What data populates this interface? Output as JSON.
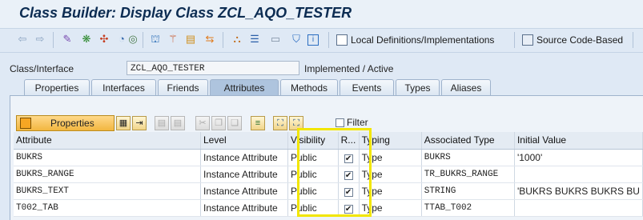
{
  "window": {
    "title": "Class Builder: Display Class ZCL_AQO_TESTER"
  },
  "toolbar": {
    "back_icon": "arrow-left-icon",
    "forward_icon": "arrow-right-icon",
    "local_definitions_label": "Local Definitions/Implementations",
    "source_code_label": "Source Code-Based"
  },
  "class_field": {
    "label": "Class/Interface",
    "value": "ZCL_AQO_TESTER",
    "status": "Implemented / Active"
  },
  "tabs": [
    {
      "label": "Properties"
    },
    {
      "label": "Interfaces"
    },
    {
      "label": "Friends"
    },
    {
      "label": "Attributes",
      "active": true
    },
    {
      "label": "Methods"
    },
    {
      "label": "Events"
    },
    {
      "label": "Types"
    },
    {
      "label": "Aliases"
    }
  ],
  "attributes_toolbar": {
    "properties_label": "Properties",
    "filter_label": "Filter",
    "filter_checked": false
  },
  "grid": {
    "columns": [
      "Attribute",
      "Level",
      "Visibility",
      "R...",
      "Typing",
      "Associated Type",
      "Initial Value"
    ],
    "rows": [
      {
        "attribute": "BUKRS",
        "level": "Instance Attribute",
        "visibility": "Public",
        "readonly": true,
        "typing": "Type",
        "associated_type": "BUKRS",
        "initial_value": "'1000'"
      },
      {
        "attribute": "BUKRS_RANGE",
        "level": "Instance Attribute",
        "visibility": "Public",
        "readonly": true,
        "typing": "Type",
        "associated_type": "TR_BUKRS_RANGE",
        "initial_value": ""
      },
      {
        "attribute": "BUKRS_TEXT",
        "level": "Instance Attribute",
        "visibility": "Public",
        "readonly": true,
        "typing": "Type",
        "associated_type": "STRING",
        "initial_value": "'BUKRS BUKRS BUKRS BU"
      },
      {
        "attribute": "T002_TAB",
        "level": "Instance Attribute",
        "visibility": "Public",
        "readonly": true,
        "typing": "Type",
        "associated_type": "TTAB_T002",
        "initial_value": ""
      }
    ]
  },
  "colors": {
    "highlight": "#f2e600",
    "title": "#0c2c52",
    "background": "#dfe9f5"
  }
}
